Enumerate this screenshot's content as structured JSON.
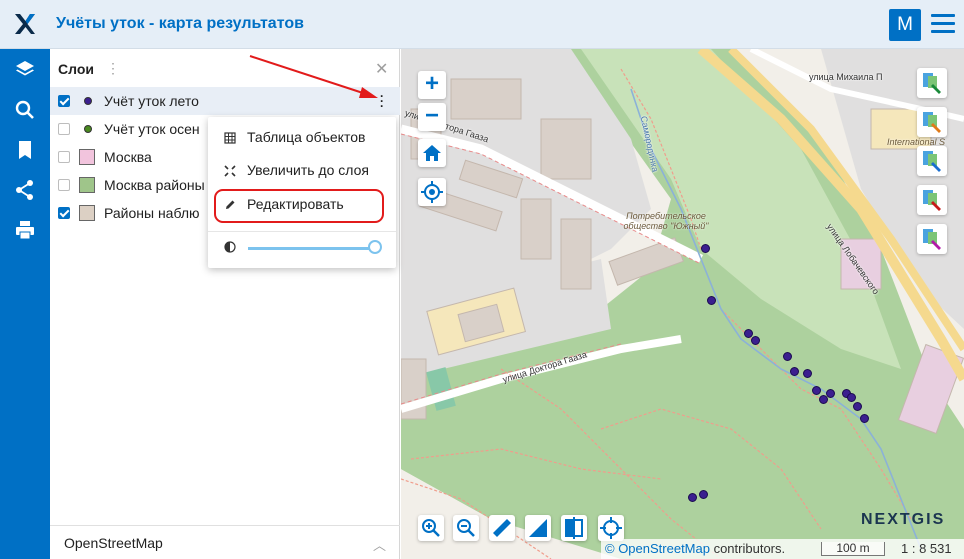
{
  "header": {
    "title": "Учёты уток - карта результатов",
    "avatar_letter": "M",
    "brand_color": "#0070c5"
  },
  "left_toolbar": {
    "icons": [
      "layers-icon",
      "search-icon",
      "bookmark-icon",
      "share-icon",
      "print-icon"
    ]
  },
  "layers_panel": {
    "title": "Слои",
    "layers": [
      {
        "label": "Учёт уток лето",
        "checked": true,
        "symbol": "dot",
        "color": "#3b1f8f"
      },
      {
        "label": "Учёт уток осен",
        "checked": false,
        "symbol": "dot",
        "color": "#4a8a20"
      },
      {
        "label": "Москва",
        "checked": false,
        "symbol": "box",
        "color": "#f2c4dd"
      },
      {
        "label": "Москва районы",
        "checked": false,
        "symbol": "box",
        "color": "#9fc58a"
      },
      {
        "label": "Районы наблю",
        "checked": true,
        "symbol": "box",
        "color": "#dcd0c4"
      }
    ],
    "basemap": "OpenStreetMap"
  },
  "layer_menu": {
    "items": [
      "Таблица объектов",
      "Увеличить до слоя",
      "Редактировать"
    ],
    "opacity": 1.0
  },
  "map": {
    "labels": {
      "street1": "улица Доктора Гааза",
      "street2": "улица Доктора Гааза",
      "street3": "улица Михаила П",
      "street4": "улица Лобачевского",
      "stream": "Самородинка",
      "poi": "Потребительское общество \"Южный\"",
      "school": "International S"
    },
    "attribution_link": "© OpenStreetMap",
    "attribution_rest": " contributors.",
    "scale_bar": "100 m",
    "scale_ratio": "1 : 8 531",
    "brand": "NEXTGIS"
  }
}
